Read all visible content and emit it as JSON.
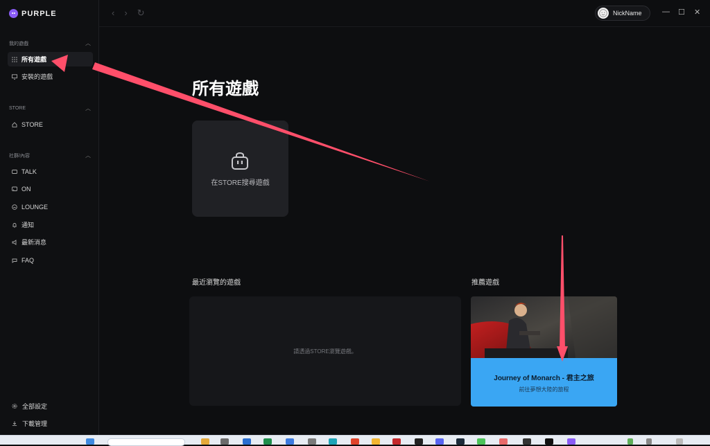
{
  "app": {
    "brand": "PURPLE"
  },
  "sidebar": {
    "sections": [
      {
        "title": "我的遊戲",
        "items": [
          {
            "label": "所有遊戲",
            "icon": "grid-icon",
            "active": true
          },
          {
            "label": "安裝的遊戲",
            "icon": "monitor-icon",
            "active": false
          }
        ]
      },
      {
        "title": "STORE",
        "items": [
          {
            "label": "STORE",
            "icon": "home-icon",
            "active": false
          }
        ]
      },
      {
        "title": "社群/內容",
        "items": [
          {
            "label": "TALK",
            "icon": "chat-icon"
          },
          {
            "label": "ON",
            "icon": "cast-icon"
          },
          {
            "label": "LOUNGE",
            "icon": "lounge-icon"
          },
          {
            "label": "通知",
            "icon": "bell-icon"
          },
          {
            "label": "最新消息",
            "icon": "megaphone-icon"
          },
          {
            "label": "FAQ",
            "icon": "comment-icon"
          }
        ]
      }
    ],
    "bottom": [
      {
        "label": "全部設定",
        "icon": "gear-icon"
      },
      {
        "label": "下載管理",
        "icon": "download-icon"
      }
    ]
  },
  "header": {
    "username": "NickName"
  },
  "main": {
    "title": "所有遊戲",
    "store_card_label": "在STORE搜尋遊戲",
    "recent": {
      "label": "最近瀏覽的遊戲",
      "empty_text": "請透過STORE瀏覽遊戲。"
    },
    "recommended": {
      "label": "推薦遊戲",
      "title": "Journey of Monarch - 君主之旅",
      "subtitle": "前往夢想大陸的旅程"
    }
  },
  "colors": {
    "accent": "#8a5cf6",
    "recommend_bg": "#3aa6f3",
    "annotation_arrow": "#ff4f6a"
  }
}
